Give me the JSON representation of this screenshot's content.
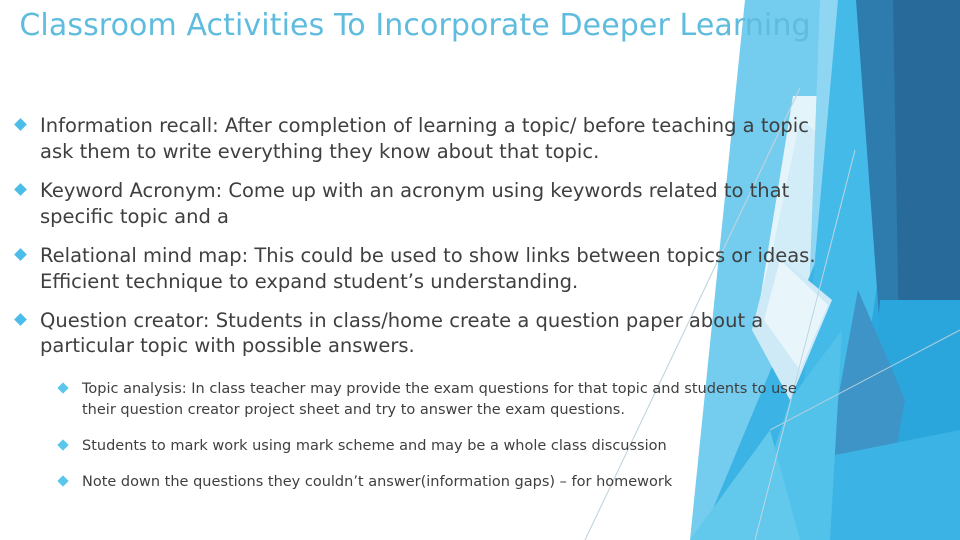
{
  "slide": {
    "title": "Classroom Activities To Incorporate Deeper Learning",
    "title_color": "#5FBCDE",
    "body_text_color": "#3F3F3F",
    "bullet_marker_color": "#4CBCE8",
    "sub_bullet_marker_color": "#59C6EC",
    "background_color": "#FFFFFF",
    "bullet_glyph": "diamond-bullet"
  },
  "bullets": [
    {
      "text": "Information recall: After completion of learning a topic/ before teaching a topic ask them to write  everything they know about that topic."
    },
    {
      "text": " Keyword Acronym: Come up with an acronym using keywords related to that specific topic and a"
    },
    {
      "text": "Relational mind map: This could be used to show links between topics or ideas. Efficient technique to expand student’s understanding."
    },
    {
      "text": "Question creator: Students in class/home create a question paper about a particular topic with possible answers."
    }
  ],
  "sub_bullets": [
    {
      "text": "Topic analysis: In class teacher may provide the exam questions for that topic and students to use their question creator project sheet and try to answer the exam questions."
    },
    {
      "text": "Students to mark work using mark scheme and may be a whole class discussion"
    },
    {
      "text": "Note down the questions they couldn’t answer(information gaps) – for homework"
    }
  ],
  "decoration": {
    "name": "faceted-blue-polygons",
    "colors": {
      "pale_ice": "#D6EFF9",
      "light_sky": "#8FD6F2",
      "sky": "#74CCEE",
      "cyan": "#3BB3E4",
      "azure": "#2AA8DF",
      "mid_blue": "#3E94C6",
      "steel_blue": "#2E7BAE",
      "deep_blue": "#286B9B",
      "hairline": "#BFD4DE"
    }
  }
}
